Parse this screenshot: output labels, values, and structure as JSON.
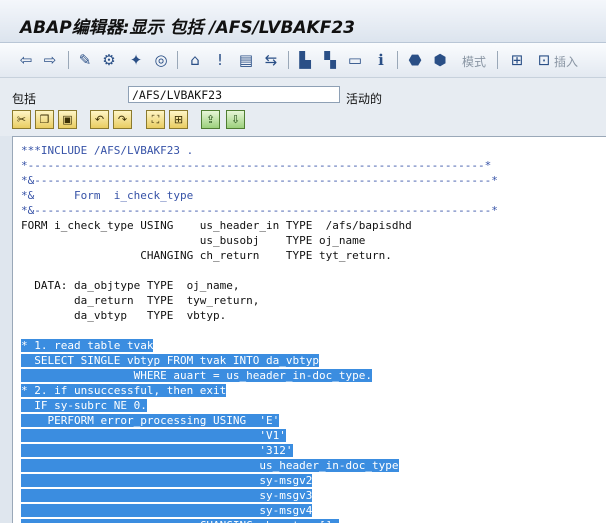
{
  "window": {
    "title": "ABAP编辑器:显示 包括 /AFS/LVBAKF23"
  },
  "toolbar": {
    "items": [
      {
        "icon": "back-arrow-icon",
        "glyph": "⇦"
      },
      {
        "icon": "forward-arrow-icon",
        "glyph": "⇨"
      },
      {
        "icon": "display-change-icon",
        "glyph": "✎"
      },
      {
        "icon": "other-object-icon",
        "glyph": "⚙"
      },
      {
        "icon": "check-icon",
        "glyph": "✦"
      },
      {
        "icon": "activate-icon",
        "glyph": "◎"
      },
      {
        "icon": "where-used-icon",
        "glyph": "⌂"
      },
      {
        "icon": "test-run-icon",
        "glyph": "!"
      },
      {
        "icon": "object-list-icon",
        "glyph": "▤"
      },
      {
        "icon": "navigation-icon",
        "glyph": "⇆"
      },
      {
        "icon": "hierarchy-icon",
        "glyph": "▙"
      },
      {
        "icon": "enhance-icon",
        "glyph": "▚"
      },
      {
        "icon": "window-icon",
        "glyph": "▭"
      },
      {
        "icon": "info-icon",
        "glyph": "ℹ"
      },
      {
        "icon": "breakpoint-icon",
        "glyph": "⬣"
      },
      {
        "icon": "session-breakpoint-icon",
        "glyph": "⬢"
      },
      {
        "icon": "pattern-icon",
        "glyph": "⊞"
      },
      {
        "icon": "insert-icon",
        "glyph": "⊡"
      }
    ],
    "pattern_label": "模式",
    "insert_label": "插入"
  },
  "field": {
    "label": "包括",
    "value": "/AFS/LVBAKF23",
    "status": "活动的"
  },
  "editbar": {
    "items": [
      {
        "icon": "cut-icon",
        "glyph": "✂"
      },
      {
        "icon": "copy-icon",
        "glyph": "❐"
      },
      {
        "icon": "paste-icon",
        "glyph": "▣"
      },
      {
        "icon": "undo-icon",
        "glyph": "↶"
      },
      {
        "icon": "redo-icon",
        "glyph": "↷"
      },
      {
        "icon": "mark-block-icon",
        "glyph": "⛶"
      },
      {
        "icon": "pretty-printer-icon",
        "glyph": "⊞"
      },
      {
        "icon": "upload-icon",
        "glyph": "⇪"
      },
      {
        "icon": "download-icon",
        "glyph": "⇩"
      }
    ]
  },
  "code": {
    "lines": [
      {
        "text": "***INCLUDE /AFS/LVBAKF23 .",
        "cls": "cm"
      },
      {
        "text": "*---------------------------------------------------------------------*",
        "cls": "cm"
      },
      {
        "text": "*&---------------------------------------------------------------------*",
        "cls": "cm"
      },
      {
        "text": "*&      Form  i_check_type",
        "cls": "cm"
      },
      {
        "text": "*&---------------------------------------------------------------------*",
        "cls": "cm"
      },
      {
        "text": "FORM i_check_type USING    us_header_in TYPE  /afs/bapisdhd",
        "cls": ""
      },
      {
        "text": "                           us_busobj    TYPE oj_name",
        "cls": ""
      },
      {
        "text": "                  CHANGING ch_return    TYPE tyt_return.",
        "cls": ""
      },
      {
        "text": "",
        "cls": ""
      },
      {
        "text": "  DATA: da_objtype TYPE  oj_name,",
        "cls": ""
      },
      {
        "text": "        da_return  TYPE  tyw_return,",
        "cls": ""
      },
      {
        "text": "        da_vbtyp   TYPE  vbtyp.",
        "cls": ""
      },
      {
        "text": "",
        "cls": ""
      },
      {
        "text": "* 1. read table tvak",
        "cls": "cm sel"
      },
      {
        "text": "  SELECT SINGLE vbtyp FROM tvak INTO da_vbtyp",
        "cls": "sel"
      },
      {
        "text": "                 WHERE auart = us_header_in-doc_type.",
        "cls": "sel"
      },
      {
        "text": "* 2. if unsuccessful, then exit",
        "cls": "cm sel"
      },
      {
        "text": "  IF sy-subrc NE 0.",
        "cls": "sel"
      },
      {
        "text": "    PERFORM error_processing USING  'E'",
        "cls": "sel"
      },
      {
        "text": "                                    'V1'",
        "cls": "sel"
      },
      {
        "text": "                                    '312'",
        "cls": "sel"
      },
      {
        "text": "                                    us_header_in-doc_type",
        "cls": "sel"
      },
      {
        "text": "                                    sy-msgv2",
        "cls": "sel"
      },
      {
        "text": "                                    sy-msgv3",
        "cls": "sel"
      },
      {
        "text": "                                    sy-msgv4",
        "cls": "sel"
      },
      {
        "text": "                           CHANGING ch_return[].",
        "cls": "sel"
      }
    ]
  }
}
